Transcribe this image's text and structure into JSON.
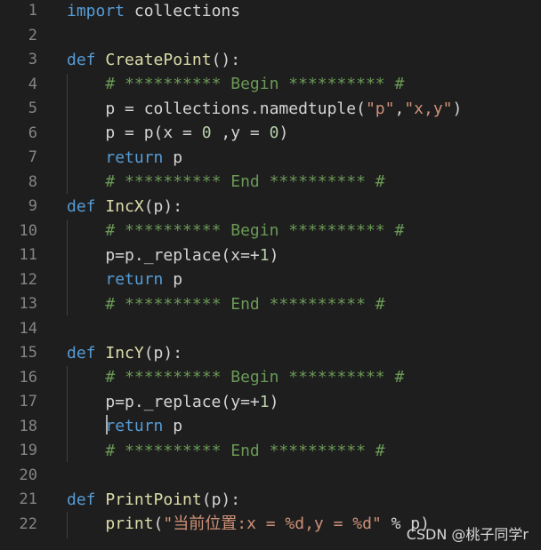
{
  "editor": {
    "lines": [
      {
        "num": "1",
        "parts": [
          {
            "t": "import",
            "c": "kw"
          },
          {
            "t": " collections",
            "c": ""
          }
        ]
      },
      {
        "num": "2",
        "parts": []
      },
      {
        "num": "3",
        "parts": [
          {
            "t": "def",
            "c": "kw"
          },
          {
            "t": " ",
            "c": ""
          },
          {
            "t": "CreatePoint",
            "c": "fn"
          },
          {
            "t": "():",
            "c": ""
          }
        ]
      },
      {
        "num": "4",
        "parts": [
          {
            "t": "    ",
            "c": ""
          },
          {
            "t": "# ********** Begin ********** #",
            "c": "cm"
          }
        ]
      },
      {
        "num": "5",
        "parts": [
          {
            "t": "    p = collections.namedtuple(",
            "c": ""
          },
          {
            "t": "\"p\"",
            "c": "str"
          },
          {
            "t": ",",
            "c": ""
          },
          {
            "t": "\"x,y\"",
            "c": "str"
          },
          {
            "t": ")",
            "c": ""
          }
        ]
      },
      {
        "num": "6",
        "parts": [
          {
            "t": "    p = p(x = ",
            "c": ""
          },
          {
            "t": "0",
            "c": "num"
          },
          {
            "t": " ,y = ",
            "c": ""
          },
          {
            "t": "0",
            "c": "num"
          },
          {
            "t": ")",
            "c": ""
          }
        ]
      },
      {
        "num": "7",
        "parts": [
          {
            "t": "    ",
            "c": ""
          },
          {
            "t": "return",
            "c": "kw"
          },
          {
            "t": " p",
            "c": ""
          }
        ]
      },
      {
        "num": "8",
        "parts": [
          {
            "t": "    ",
            "c": ""
          },
          {
            "t": "# ********** End ********** #",
            "c": "cm"
          }
        ]
      },
      {
        "num": "9",
        "parts": [
          {
            "t": "def",
            "c": "kw"
          },
          {
            "t": " ",
            "c": ""
          },
          {
            "t": "IncX",
            "c": "fn"
          },
          {
            "t": "(p):",
            "c": ""
          }
        ]
      },
      {
        "num": "10",
        "parts": [
          {
            "t": "    ",
            "c": ""
          },
          {
            "t": "# ********** Begin ********** #",
            "c": "cm"
          }
        ]
      },
      {
        "num": "11",
        "parts": [
          {
            "t": "    p=p._replace(x=+",
            "c": ""
          },
          {
            "t": "1",
            "c": "num"
          },
          {
            "t": ")",
            "c": ""
          }
        ]
      },
      {
        "num": "12",
        "parts": [
          {
            "t": "    ",
            "c": ""
          },
          {
            "t": "return",
            "c": "kw"
          },
          {
            "t": " p",
            "c": ""
          }
        ]
      },
      {
        "num": "13",
        "parts": [
          {
            "t": "    ",
            "c": ""
          },
          {
            "t": "# ********** End ********** #",
            "c": "cm"
          }
        ]
      },
      {
        "num": "14",
        "parts": []
      },
      {
        "num": "15",
        "parts": [
          {
            "t": "def",
            "c": "kw"
          },
          {
            "t": " ",
            "c": ""
          },
          {
            "t": "IncY",
            "c": "fn"
          },
          {
            "t": "(p):",
            "c": ""
          }
        ]
      },
      {
        "num": "16",
        "parts": [
          {
            "t": "    ",
            "c": ""
          },
          {
            "t": "# ********** Begin ********** #",
            "c": "cm"
          }
        ]
      },
      {
        "num": "17",
        "parts": [
          {
            "t": "    p=p._replace(y=+",
            "c": ""
          },
          {
            "t": "1",
            "c": "num"
          },
          {
            "t": ")",
            "c": ""
          }
        ]
      },
      {
        "num": "18",
        "parts": [
          {
            "t": "    ",
            "c": ""
          },
          {
            "t": "return",
            "c": "kw"
          },
          {
            "t": " p",
            "c": ""
          }
        ]
      },
      {
        "num": "19",
        "parts": [
          {
            "t": "    ",
            "c": ""
          },
          {
            "t": "# ********** End ********** #",
            "c": "cm"
          }
        ]
      },
      {
        "num": "20",
        "parts": []
      },
      {
        "num": "21",
        "parts": [
          {
            "t": "def",
            "c": "kw"
          },
          {
            "t": " ",
            "c": ""
          },
          {
            "t": "PrintPoint",
            "c": "fn"
          },
          {
            "t": "(p):",
            "c": ""
          }
        ]
      },
      {
        "num": "22",
        "parts": [
          {
            "t": "    ",
            "c": ""
          },
          {
            "t": "print",
            "c": "fn"
          },
          {
            "t": "(",
            "c": ""
          },
          {
            "t": "\"当前位置:x = %d,y = %d\"",
            "c": "str"
          },
          {
            "t": " % p)",
            "c": ""
          }
        ]
      }
    ]
  },
  "watermark": "CSDN @桃子同学r",
  "colors": {
    "background": "#1e1e1e",
    "keyword": "#569cd6",
    "function": "#dcdcaa",
    "string": "#ce9178",
    "number": "#b5cea8",
    "comment": "#6a9955",
    "text": "#d4d4d4",
    "line_number": "#858585"
  }
}
